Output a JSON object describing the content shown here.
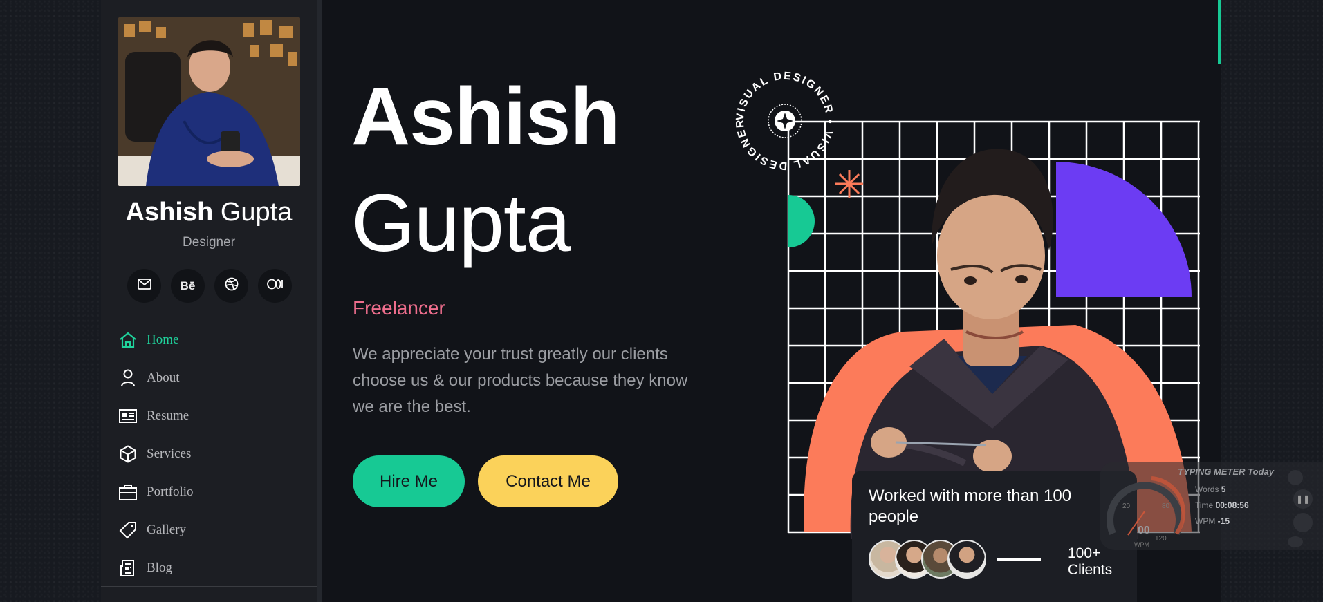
{
  "profile": {
    "first_name": "Ashish",
    "last_name": "Gupta",
    "role": "Designer",
    "socials": [
      {
        "icon": "mail-icon"
      },
      {
        "icon": "behance-icon",
        "label": "Bē"
      },
      {
        "icon": "dribbble-icon"
      },
      {
        "icon": "medium-icon"
      }
    ]
  },
  "nav": {
    "items": [
      {
        "label": "Home",
        "icon": "home-icon",
        "active": true
      },
      {
        "label": "About",
        "icon": "user-icon"
      },
      {
        "label": "Resume",
        "icon": "id-card-icon"
      },
      {
        "label": "Services",
        "icon": "cube-icon"
      },
      {
        "label": "Portfolio",
        "icon": "briefcase-icon"
      },
      {
        "label": "Gallery",
        "icon": "tag-icon"
      },
      {
        "label": "Blog",
        "icon": "newspaper-icon"
      }
    ]
  },
  "hero": {
    "first_name": "Ashish",
    "last_name": "Gupta",
    "tagline": "Freelancer",
    "description": "We appreciate your trust greatly our clients choose us & our products because they know we are the best.",
    "hire_label": "Hire Me",
    "contact_label": "Contact Me",
    "badge_text": "VISUAL DESIGNER • VISUAL DESIGNER •"
  },
  "stats": {
    "text": "Worked with more than 100 people",
    "count_line1": "100+",
    "count_line2": "Clients"
  },
  "typing_meter": {
    "title": "TYPING METER Today",
    "words_label": "Words",
    "words_value": "5",
    "time_label": "Time",
    "time_value": "00:08:56",
    "wpm_label": "WPM",
    "wpm_value": "-15",
    "gauge_value": "00",
    "gauge_unit": "WPM",
    "gauge_ticks": [
      "20",
      "80",
      "120"
    ]
  },
  "colors": {
    "accent_green": "#17c994",
    "accent_yellow": "#fbd25a",
    "accent_pink": "#ef6e8d",
    "accent_coral": "#fc7b5a",
    "accent_purple": "#6c3cf3"
  }
}
